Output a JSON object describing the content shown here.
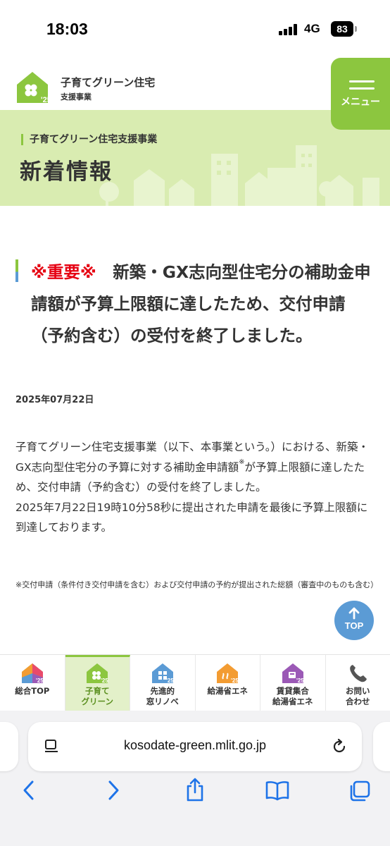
{
  "status_bar": {
    "time": "18:03",
    "network": "4G",
    "battery": "83"
  },
  "header": {
    "site_name": "子育てグリーン住宅",
    "site_sub": "支援事業",
    "logo_year": "'25",
    "menu_label": "メニュー"
  },
  "hero": {
    "subtitle": "子育てグリーン住宅支援事業",
    "title": "新着情報"
  },
  "article": {
    "important_tag": "※重要※",
    "title": "　新築・GX志向型住宅分の補助金申請額が予算上限額に達したため、交付申請（予約含む）の受付を終了しました。",
    "date": "2025年07月22日",
    "body_1a": "子育てグリーン住宅支援事業（以下、本事業という。）における、新築・GX志向型住宅分の予算に対する補助金申請額",
    "body_1_sup": "※",
    "body_1b": "が予算上限額に達したため、交付申請（予約含む）の受付を終了しました。",
    "body_2": "2025年7月22日19時10分58秒に提出された申請を最後に予算上限額に到達しております。",
    "note": "※交付申請（条件付き交付申請を含む）および交付申請の予約が提出された総額（審査中のものも含む）"
  },
  "top_button": {
    "label": "TOP"
  },
  "category_nav": [
    {
      "label": "総合TOP",
      "icon": "multicolor-house-icon"
    },
    {
      "label": "子育て\nグリーン",
      "icon": "green-clover-house-icon",
      "active": true
    },
    {
      "label": "先進的\n窓リノベ",
      "icon": "blue-window-house-icon"
    },
    {
      "label": "給湯省エネ",
      "icon": "orange-water-heater-house-icon"
    },
    {
      "label": "賃貸集合\n給湯省エネ",
      "icon": "purple-apartment-house-icon"
    },
    {
      "label": "お問い\n合わせ",
      "icon": "phone-icon"
    }
  ],
  "browser": {
    "url": "kosodate-green.mlit.go.jp"
  },
  "colors": {
    "brand_green": "#8cc63f",
    "accent_blue": "#5b9bd5",
    "important_red": "#e60012"
  }
}
